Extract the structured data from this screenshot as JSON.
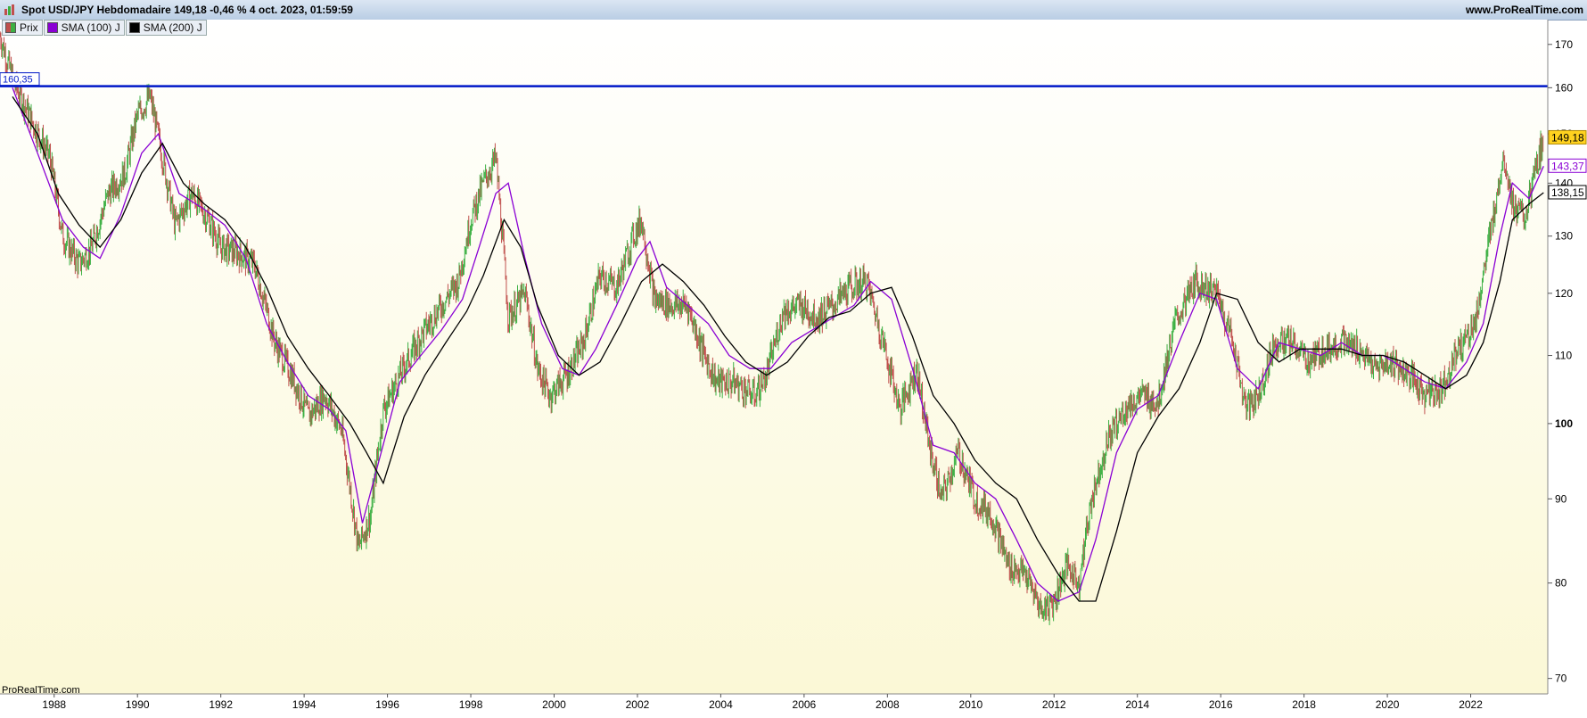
{
  "header": {
    "title": "Spot USD/JPY Hebdomadaire 149,18 -0,46 % 4 oct. 2023, 01:59:59",
    "site": "www.ProRealTime.com"
  },
  "legend": [
    {
      "label": "Prix",
      "color": "#4caf50"
    },
    {
      "label": "SMA (100) J",
      "color": "#8a00d4"
    },
    {
      "label": "SMA (200) J",
      "color": "#000000"
    }
  ],
  "watermark": "ProRealTime.com",
  "colors": {
    "up": "#3cb043",
    "down": "#c0504d",
    "sma100": "#8a00d4",
    "sma200": "#000000",
    "hline": "#0018c8"
  },
  "chart_data": {
    "type": "line",
    "title": "Spot USD/JPY Hebdomadaire",
    "price_scale": "log",
    "ylim": [
      68.5,
      176
    ],
    "xlim": [
      1986.7,
      2023.85
    ],
    "y_ticks": [
      {
        "v": 170,
        "label": "170"
      },
      {
        "v": 160,
        "label": "160"
      },
      {
        "v": 150,
        "label": "150"
      },
      {
        "v": 140,
        "label": "140"
      },
      {
        "v": 130,
        "label": "130"
      },
      {
        "v": 120,
        "label": "120"
      },
      {
        "v": 110,
        "label": "110"
      },
      {
        "v": 100,
        "label": "100"
      },
      {
        "v": 90,
        "label": "90"
      },
      {
        "v": 80,
        "label": "80"
      },
      {
        "v": 70,
        "label": "70"
      }
    ],
    "x_ticks": [
      "1988",
      "1990",
      "1992",
      "1994",
      "1996",
      "1998",
      "2000",
      "2002",
      "2004",
      "2006",
      "2008",
      "2010",
      "2012",
      "2014",
      "2016",
      "2018",
      "2020",
      "2022"
    ],
    "horizontal_line": {
      "value": 160.35,
      "label": "160,35"
    },
    "last_values": [
      {
        "name": "Prix",
        "value": 149.18,
        "label": "149,18"
      },
      {
        "name": "SMA (100) J",
        "value": 143.37,
        "label": "143,37"
      },
      {
        "name": "SMA (200) J",
        "value": 138.15,
        "label": "138,15"
      }
    ],
    "series": [
      {
        "name": "Prix",
        "x": [
          1986.7,
          1987.0,
          1987.5,
          1987.9,
          1988.2,
          1988.6,
          1988.9,
          1989.3,
          1989.7,
          1990.0,
          1990.3,
          1990.6,
          1990.9,
          1991.3,
          1991.7,
          1992.0,
          1992.4,
          1992.8,
          1993.3,
          1993.7,
          1994.1,
          1994.5,
          1994.9,
          1995.3,
          1995.6,
          1995.9,
          1996.3,
          1996.8,
          1997.3,
          1997.7,
          1998.0,
          1998.3,
          1998.6,
          1998.9,
          1999.3,
          1999.6,
          1999.9,
          2000.3,
          2000.7,
          2001.1,
          2001.5,
          2001.9,
          2002.1,
          2002.4,
          2002.8,
          2003.2,
          2003.6,
          2003.9,
          2004.3,
          2004.8,
          2005.1,
          2005.5,
          2005.9,
          2006.3,
          2006.7,
          2007.1,
          2007.5,
          2007.9,
          2008.3,
          2008.7,
          2009.0,
          2009.3,
          2009.7,
          2010.1,
          2010.5,
          2010.9,
          2011.3,
          2011.7,
          2012.0,
          2012.3,
          2012.6,
          2012.9,
          2013.3,
          2013.7,
          2014.1,
          2014.5,
          2014.9,
          2015.4,
          2015.9,
          2016.3,
          2016.6,
          2016.9,
          2017.3,
          2017.7,
          2018.1,
          2018.5,
          2018.9,
          2019.3,
          2019.7,
          2020.1,
          2020.5,
          2020.9,
          2021.3,
          2021.7,
          2022.1,
          2022.4,
          2022.8,
          2023.0,
          2023.3,
          2023.75
        ],
        "y": [
          172,
          162,
          152,
          145,
          130,
          125,
          128,
          138,
          142,
          154,
          158,
          145,
          132,
          138,
          133,
          128,
          127,
          125,
          112,
          107,
          101,
          104,
          99,
          84,
          88,
          102,
          107,
          113,
          118,
          122,
          133,
          140,
          145,
          116,
          120,
          108,
          104,
          107,
          112,
          123,
          121,
          130,
          133,
          119,
          118,
          118,
          110,
          106,
          106,
          104,
          107,
          117,
          118,
          116,
          118,
          121,
          122,
          112,
          102,
          108,
          97,
          90,
          96,
          90,
          88,
          82,
          81,
          77,
          78,
          82,
          80,
          90,
          98,
          102,
          104,
          103,
          115,
          122,
          120,
          112,
          102,
          104,
          112,
          112,
          109,
          111,
          112,
          111,
          108,
          109,
          107,
          104,
          105,
          111,
          115,
          127,
          146,
          136,
          133,
          149.18
        ]
      },
      {
        "name": "SMA (100) J",
        "x": [
          1987.0,
          1987.6,
          1988.2,
          1988.7,
          1989.1,
          1989.6,
          1990.1,
          1990.5,
          1991.0,
          1991.6,
          1992.1,
          1992.6,
          1993.1,
          1993.6,
          1994.1,
          1994.6,
          1995.0,
          1995.4,
          1995.8,
          1996.3,
          1996.8,
          1997.3,
          1997.8,
          1998.2,
          1998.6,
          1998.9,
          1999.3,
          1999.7,
          2000.2,
          2000.6,
          2001.0,
          2001.5,
          2002.0,
          2002.3,
          2002.7,
          2003.2,
          2003.7,
          2004.2,
          2004.7,
          2005.2,
          2005.7,
          2006.2,
          2006.7,
          2007.2,
          2007.6,
          2008.1,
          2008.6,
          2009.1,
          2009.6,
          2010.1,
          2010.6,
          2011.1,
          2011.6,
          2012.1,
          2012.6,
          2013.0,
          2013.5,
          2014.0,
          2014.5,
          2015.0,
          2015.5,
          2015.9,
          2016.4,
          2016.9,
          2017.4,
          2017.9,
          2018.4,
          2018.9,
          2019.4,
          2019.9,
          2020.4,
          2020.9,
          2021.4,
          2021.9,
          2022.3,
          2022.7,
          2023.0,
          2023.4,
          2023.75
        ],
        "y": [
          160,
          146,
          133,
          128,
          126,
          134,
          146,
          150,
          138,
          135,
          132,
          126,
          115,
          109,
          104,
          102,
          99,
          87,
          95,
          106,
          110,
          114,
          119,
          128,
          138,
          140,
          126,
          115,
          108,
          107,
          111,
          118,
          126,
          129,
          121,
          118,
          115,
          110,
          108,
          108,
          112,
          114,
          116,
          118,
          122,
          119,
          108,
          97,
          96,
          92,
          90,
          85,
          80,
          78,
          79,
          85,
          96,
          102,
          104,
          112,
          120,
          119,
          108,
          105,
          112,
          111,
          110,
          112,
          110,
          110,
          108,
          106,
          105,
          109,
          115,
          130,
          140,
          137,
          143.37
        ]
      },
      {
        "name": "SMA (200) J",
        "x": [
          1987.0,
          1987.6,
          1988.1,
          1988.6,
          1989.1,
          1989.6,
          1990.1,
          1990.6,
          1991.1,
          1991.6,
          1992.1,
          1992.6,
          1993.1,
          1993.6,
          1994.1,
          1994.6,
          1995.1,
          1995.5,
          1995.9,
          1996.4,
          1996.9,
          1997.4,
          1997.9,
          1998.3,
          1998.8,
          1999.2,
          1999.6,
          2000.1,
          2000.6,
          2001.1,
          2001.6,
          2002.1,
          2002.6,
          2003.1,
          2003.6,
          2004.1,
          2004.6,
          2005.1,
          2005.6,
          2006.1,
          2006.6,
          2007.1,
          2007.6,
          2008.1,
          2008.6,
          2009.1,
          2009.6,
          2010.1,
          2010.6,
          2011.1,
          2011.6,
          2012.1,
          2012.6,
          2013.0,
          2013.5,
          2014.0,
          2014.5,
          2015.0,
          2015.5,
          2015.9,
          2016.4,
          2016.9,
          2017.4,
          2017.9,
          2018.4,
          2018.9,
          2019.4,
          2019.9,
          2020.4,
          2020.9,
          2021.4,
          2021.9,
          2022.3,
          2022.7,
          2023.0,
          2023.4,
          2023.75
        ],
        "y": [
          158,
          150,
          138,
          132,
          128,
          133,
          142,
          148,
          140,
          136,
          133,
          128,
          121,
          113,
          108,
          104,
          100,
          96,
          92,
          101,
          107,
          112,
          117,
          123,
          133,
          128,
          118,
          110,
          107,
          109,
          115,
          122,
          125,
          122,
          118,
          113,
          109,
          107,
          109,
          113,
          116,
          117,
          120,
          121,
          113,
          104,
          100,
          95,
          92,
          90,
          85,
          81,
          78,
          78,
          86,
          96,
          101,
          105,
          112,
          120,
          119,
          112,
          109,
          111,
          111,
          111,
          110,
          110,
          109,
          107,
          105,
          107,
          112,
          122,
          133,
          136,
          138.15
        ]
      }
    ]
  }
}
